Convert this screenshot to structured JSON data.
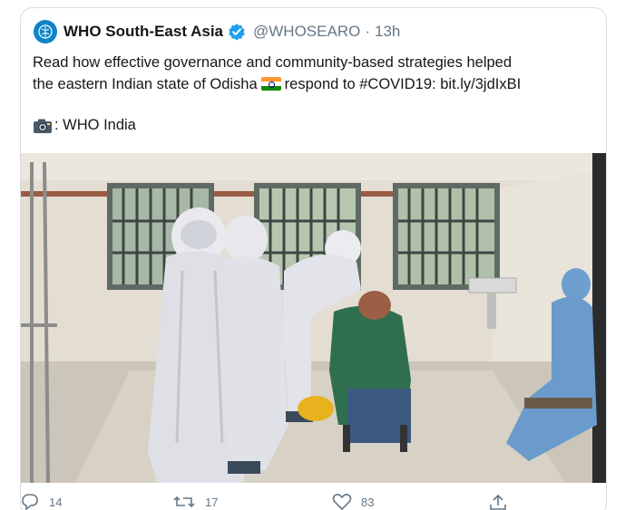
{
  "tweet": {
    "author_name": "WHO South-East Asia",
    "handle": "@WHOSEARO",
    "separator": "·",
    "time": "13h",
    "text_line1": "Read how effective governance and community-based strategies helped",
    "text_line2_a": "the eastern Indian state of Odisha",
    "text_line2_b": "respond to",
    "hashtag": "#COVID19",
    "colon": ":",
    "link": "bit.ly/3jdIxBI",
    "credit": ": WHO India"
  },
  "actions": {
    "replies": "14",
    "retweets": "17",
    "likes": "83"
  },
  "icons": {
    "avatar": "who-logo-icon",
    "verified": "verified-badge-icon",
    "flag": "india-flag-icon",
    "camera": "camera-icon",
    "reply": "reply-icon",
    "retweet": "retweet-icon",
    "like": "heart-icon",
    "share": "share-icon"
  },
  "colors": {
    "verified": "#1da1f2",
    "muted": "#657786",
    "avatar": "#0d84c6"
  }
}
